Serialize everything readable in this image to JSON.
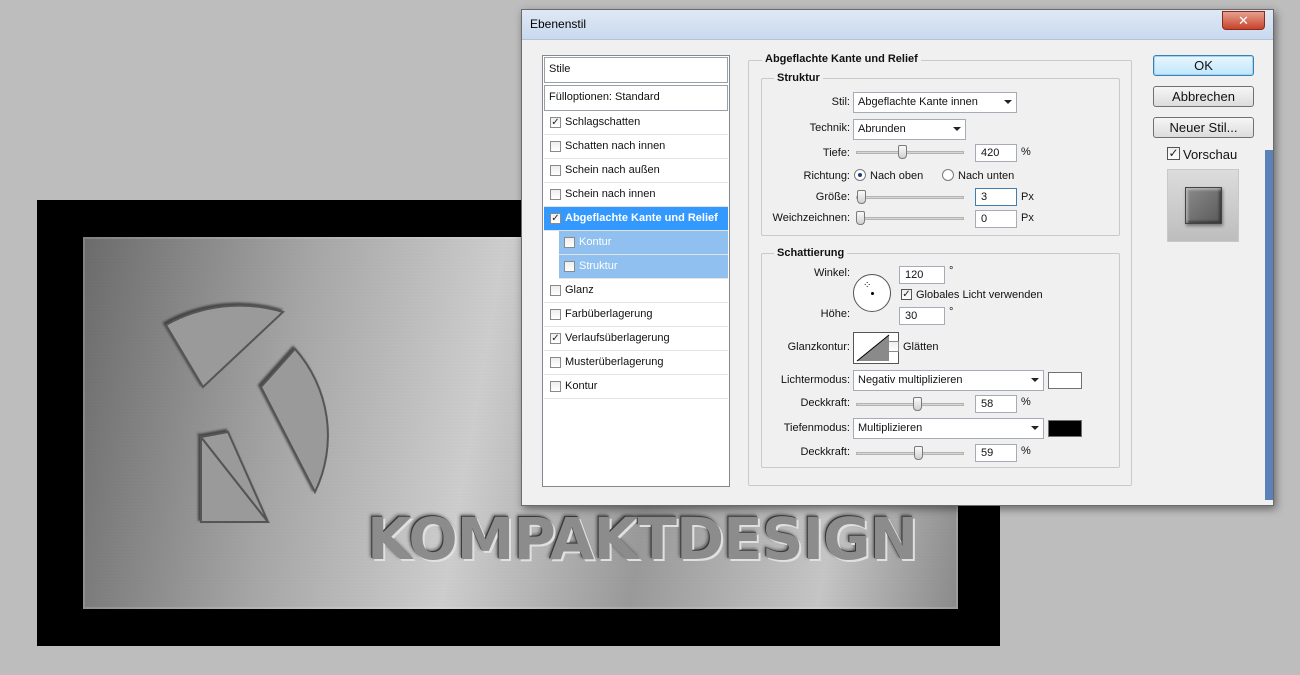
{
  "artwork": {
    "brand_text": "KOMPAKTDESIGN"
  },
  "dialog": {
    "title": "Ebenenstil",
    "close_label": "✕"
  },
  "style_list": {
    "header": "Stile",
    "fill_options": "Fülloptionen: Standard",
    "items": [
      {
        "label": "Schlagschatten",
        "checked": true,
        "mark": "✓"
      },
      {
        "label": "Schatten nach innen",
        "checked": false,
        "mark": ""
      },
      {
        "label": "Schein nach außen",
        "checked": false,
        "mark": ""
      },
      {
        "label": "Schein nach innen",
        "checked": false,
        "mark": ""
      },
      {
        "label": "Abgeflachte Kante und Relief",
        "checked": true,
        "selected": true,
        "mark": "✓"
      },
      {
        "label": "Kontur",
        "checked": false,
        "sub": true,
        "mark": ""
      },
      {
        "label": "Struktur",
        "checked": false,
        "sub": true,
        "mark": ""
      },
      {
        "label": "Glanz",
        "checked": false,
        "mark": ""
      },
      {
        "label": "Farbüberlagerung",
        "checked": false,
        "mark": ""
      },
      {
        "label": "Verlaufsüberlagerung",
        "checked": true,
        "mark": "✓"
      },
      {
        "label": "Musterüberlagerung",
        "checked": false,
        "mark": ""
      },
      {
        "label": "Kontur",
        "checked": false,
        "mark": ""
      }
    ]
  },
  "bevel": {
    "section_title": "Abgeflachte Kante und Relief",
    "structure": {
      "title": "Struktur",
      "style_label": "Stil:",
      "style_value": "Abgeflachte Kante innen",
      "technique_label": "Technik:",
      "technique_value": "Abrunden",
      "depth_label": "Tiefe:",
      "depth_value": "420",
      "depth_unit": "%",
      "depth_level": 0.42,
      "direction_label": "Richtung:",
      "direction_up": "Nach oben",
      "direction_down": "Nach unten",
      "size_label": "Größe:",
      "size_value": "3",
      "size_unit": "Px",
      "size_level": 0.01,
      "soften_label": "Weichzeichnen:",
      "soften_value": "0",
      "soften_unit": "Px",
      "soften_level": 0.0
    },
    "shading": {
      "title": "Schattierung",
      "angle_label": "Winkel:",
      "angle_value": "120",
      "degree": "°",
      "global_light_label": "Globales Licht verwenden",
      "altitude_label": "Höhe:",
      "altitude_value": "30",
      "gloss_contour_label": "Glanzkontur:",
      "antialias_label": "Glätten",
      "highlight_mode_label": "Lichtermodus:",
      "highlight_mode_value": "Negativ multiplizieren",
      "highlight_color": "#ffffff",
      "highlight_opacity_label": "Deckkraft:",
      "highlight_opacity_value": "58",
      "highlight_opacity_level": 0.58,
      "shadow_mode_label": "Tiefenmodus:",
      "shadow_mode_value": "Multiplizieren",
      "shadow_color": "#000000",
      "shadow_opacity_label": "Deckkraft:",
      "shadow_opacity_value": "59",
      "shadow_opacity_level": 0.59,
      "percent": "%"
    }
  },
  "buttons": {
    "ok": "OK",
    "cancel": "Abbrechen",
    "new_style": "Neuer Stil...",
    "preview_label": "Vorschau",
    "preview_mark": "✓"
  }
}
